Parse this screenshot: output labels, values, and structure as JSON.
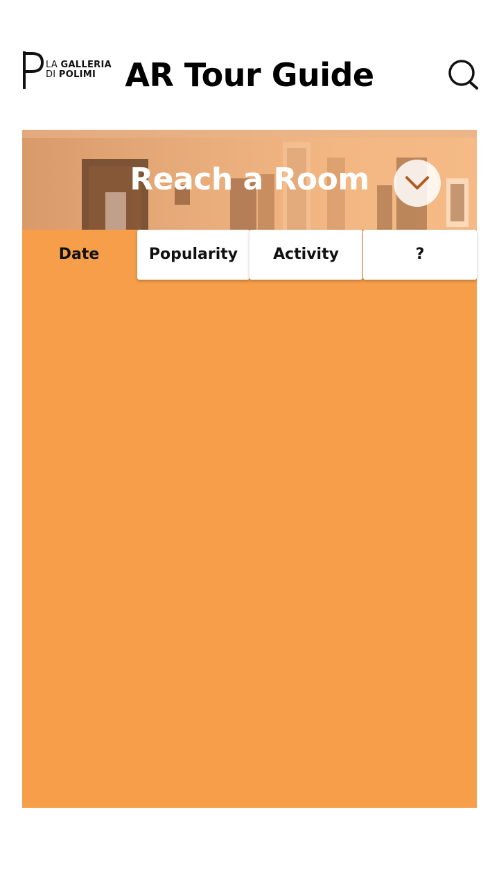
{
  "header": {
    "logo": {
      "line1_light": "LA ",
      "line1_bold": "GALLERIA",
      "line2_light": "DI ",
      "line2_bold": "POLIMI"
    },
    "title": "AR Tour Guide",
    "search_icon": "search-icon"
  },
  "banner": {
    "title": "Reach a Room",
    "dropdown_icon": "chevron-down-icon"
  },
  "tabs": [
    {
      "label": "Date",
      "active": true
    },
    {
      "label": "Popularity",
      "active": false
    },
    {
      "label": "Activity",
      "active": false
    },
    {
      "label": "?",
      "active": false
    }
  ],
  "colors": {
    "accent": "#f69e4a",
    "banner_tint": "#e9ad7c",
    "tab_bg": "#ffffff",
    "text": "#000000"
  }
}
